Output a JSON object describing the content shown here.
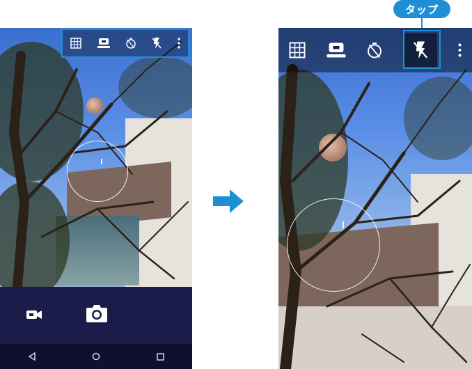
{
  "colors": {
    "accent": "#1e8fd6",
    "bottom_bar": "#1c1c4a",
    "nav_bar": "#0f0f30",
    "toolbar_icon": "#ffffff"
  },
  "left_screen": {
    "toolbar_icons": [
      "grid-icon",
      "scene-mode-icon",
      "timer-icon",
      "flash-off-icon",
      "more-vert-icon"
    ],
    "bottom_controls": [
      "video-camera-icon",
      "shutter-camera-icon"
    ],
    "nav_buttons": [
      "back-icon",
      "home-icon",
      "recents-icon"
    ]
  },
  "right_screen": {
    "toolbar_icons": [
      "grid-icon",
      "scene-mode-icon",
      "timer-icon",
      "flash-off-icon",
      "more-vert-icon"
    ],
    "highlighted_icon": "flash-off-icon"
  },
  "callout": {
    "label": "タップ"
  },
  "transition": {
    "icon": "arrow-right-icon"
  }
}
